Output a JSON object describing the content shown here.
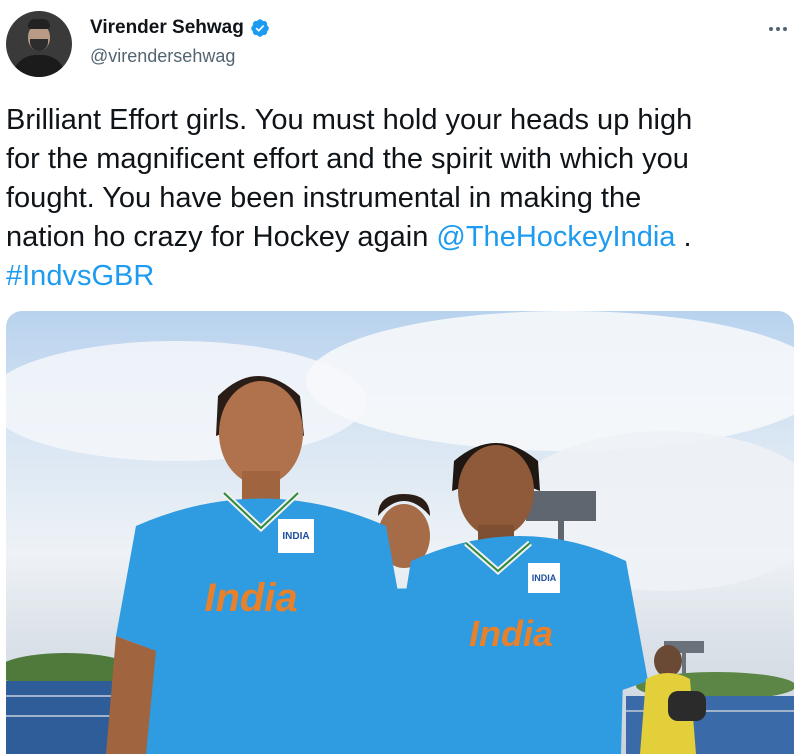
{
  "tweet": {
    "author": {
      "display_name": "Virender Sehwag",
      "handle": "@virendersehwag",
      "verified": true
    },
    "more_icon": "more-horizontal-icon",
    "text_lines": [
      "Brilliant Effort girls. You must hold your heads up high",
      "for the magnificent effort and the spirit with which you",
      "fought. You have been instrumental in making the",
      "nation ho crazy for Hockey again "
    ],
    "mention": "@TheHockeyIndia",
    "after_mention": " .",
    "hashtag": "#IndvsGBR",
    "media": {
      "jersey_text": "India",
      "badge_text": "INDIA"
    }
  },
  "colors": {
    "link": "#1d9bf0",
    "verified": "#1d9bf0",
    "jersey": "#2f9be0",
    "jersey_text": "#e8812a"
  }
}
